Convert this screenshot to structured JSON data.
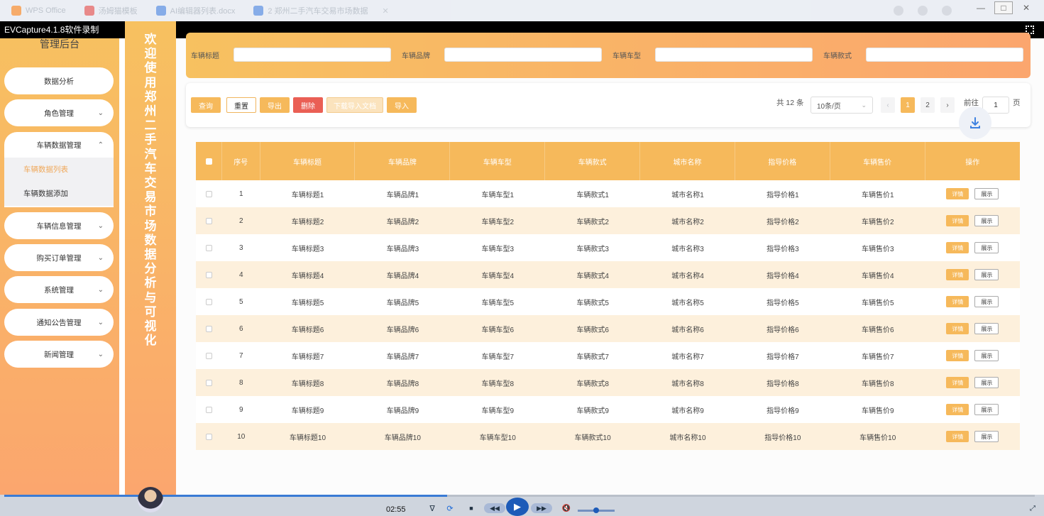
{
  "browser": {
    "tabs": [
      {
        "label": "WPS Office",
        "color": "o"
      },
      {
        "label": "汤姆猫模板",
        "color": "r"
      },
      {
        "label": "AI编辑器列表.docx",
        "color": "b"
      },
      {
        "label": "2 郑州二手汽车交易市场数据",
        "color": "b"
      }
    ],
    "minimize": "—",
    "restore": "□",
    "close": "✕"
  },
  "capture_title": "EVCapture4.1.8软件录制",
  "sidebar": {
    "brand": "管理后台",
    "items": [
      {
        "label": "数据分析",
        "chevron": ""
      },
      {
        "label": "角色管理",
        "chevron": "⌄"
      }
    ],
    "open_group": {
      "label": "车辆数据管理",
      "chevron": "⌃",
      "children": [
        "车辆数据列表",
        "车辆数据添加"
      ]
    },
    "items_after": [
      {
        "label": "车辆信息管理",
        "chevron": "⌄"
      },
      {
        "label": "购买订单管理",
        "chevron": "⌄"
      },
      {
        "label": "系统管理",
        "chevron": "⌄"
      },
      {
        "label": "通知公告管理",
        "chevron": "⌄"
      },
      {
        "label": "新闻管理",
        "chevron": "⌄"
      }
    ]
  },
  "welcome_text": [
    "欢",
    "迎",
    "使",
    "用",
    "郑",
    "州",
    "二",
    "手",
    "汽",
    "车",
    "交",
    "易",
    "市",
    "场",
    "数",
    "据",
    "分",
    "析",
    "与",
    "可",
    "视",
    "化"
  ],
  "search": {
    "fields": [
      {
        "label": "车辆标题",
        "value": ""
      },
      {
        "label": "车辆品牌",
        "value": ""
      },
      {
        "label": "车辆车型",
        "value": ""
      },
      {
        "label": "车辆款式",
        "value": ""
      }
    ]
  },
  "toolbar": {
    "query": "查询",
    "reset": "重置",
    "export": "导出",
    "delete": "删除",
    "download_template": "下载导入文档",
    "import": "导入"
  },
  "pager": {
    "total": "共 12 条",
    "page_size": "10条/页",
    "prev": "‹",
    "pages": [
      "1",
      "2"
    ],
    "next": "›",
    "goto_label": "前往",
    "goto_value": "1",
    "goto_suffix": "页"
  },
  "table": {
    "headers": [
      "序号",
      "车辆标题",
      "车辆品牌",
      "车辆车型",
      "车辆款式",
      "城市名称",
      "指导价格",
      "车辆售价",
      "操作"
    ],
    "action_detail": "详情",
    "action_show": "展示",
    "rows": [
      [
        "1",
        "车辆标题1",
        "车辆品牌1",
        "车辆车型1",
        "车辆款式1",
        "城市名称1",
        "指导价格1",
        "车辆售价1"
      ],
      [
        "2",
        "车辆标题2",
        "车辆品牌2",
        "车辆车型2",
        "车辆款式2",
        "城市名称2",
        "指导价格2",
        "车辆售价2"
      ],
      [
        "3",
        "车辆标题3",
        "车辆品牌3",
        "车辆车型3",
        "车辆款式3",
        "城市名称3",
        "指导价格3",
        "车辆售价3"
      ],
      [
        "4",
        "车辆标题4",
        "车辆品牌4",
        "车辆车型4",
        "车辆款式4",
        "城市名称4",
        "指导价格4",
        "车辆售价4"
      ],
      [
        "5",
        "车辆标题5",
        "车辆品牌5",
        "车辆车型5",
        "车辆款式5",
        "城市名称5",
        "指导价格5",
        "车辆售价5"
      ],
      [
        "6",
        "车辆标题6",
        "车辆品牌6",
        "车辆车型6",
        "车辆款式6",
        "城市名称6",
        "指导价格6",
        "车辆售价6"
      ],
      [
        "7",
        "车辆标题7",
        "车辆品牌7",
        "车辆车型7",
        "车辆款式7",
        "城市名称7",
        "指导价格7",
        "车辆售价7"
      ],
      [
        "8",
        "车辆标题8",
        "车辆品牌8",
        "车辆车型8",
        "车辆款式8",
        "城市名称8",
        "指导价格8",
        "车辆售价8"
      ],
      [
        "9",
        "车辆标题9",
        "车辆品牌9",
        "车辆车型9",
        "车辆款式9",
        "城市名称9",
        "指导价格9",
        "车辆售价9"
      ],
      [
        "10",
        "车辆标题10",
        "车辆品牌10",
        "车辆车型10",
        "车辆款式10",
        "城市名称10",
        "指导价格10",
        "车辆售价10"
      ]
    ]
  },
  "player": {
    "time": "02:55",
    "progress": 0.43,
    "volume": 0.5,
    "controls": {
      "loop": "∇",
      "refresh": "⟳",
      "stop": "■",
      "rewind": "◀◀",
      "play": "▶",
      "forward": "▶▶",
      "mute": "🔇",
      "fullscreen": "⤢"
    }
  },
  "colors": {
    "accent": "#f6b95b",
    "danger": "#ea5f55",
    "gradient_start": "#f7c160",
    "gradient_end": "#fba66e"
  }
}
